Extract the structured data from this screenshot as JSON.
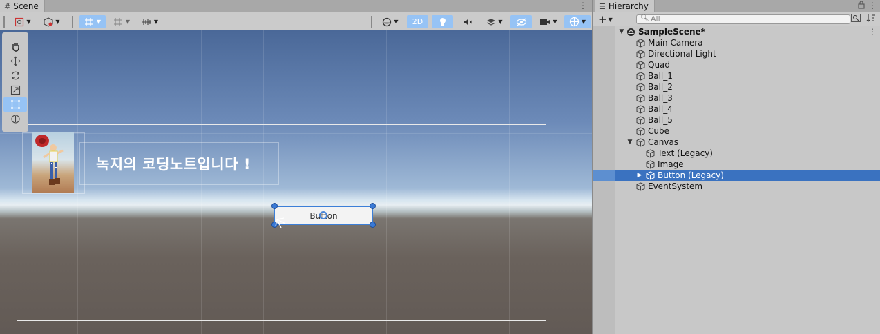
{
  "scene_panel": {
    "tab_icon": "#",
    "tab_label": "Scene",
    "menu_icon": "⋮",
    "toolbar": {
      "mode_2d_label": "2D"
    },
    "viewport": {
      "canvas_text": "녹지의 코딩노트입니다 !",
      "button_label": "Button"
    }
  },
  "hierarchy_panel": {
    "tab_label": "Hierarchy",
    "add_label": "+",
    "search_placeholder": "All",
    "items": [
      {
        "label": "SampleScene*",
        "depth": 0,
        "expanded": true,
        "is_scene": true
      },
      {
        "label": "Main Camera",
        "depth": 1
      },
      {
        "label": "Directional Light",
        "depth": 1
      },
      {
        "label": "Quad",
        "depth": 1
      },
      {
        "label": "Ball_1",
        "depth": 1
      },
      {
        "label": "Ball_2",
        "depth": 1
      },
      {
        "label": "Ball_3",
        "depth": 1
      },
      {
        "label": "Ball_4",
        "depth": 1
      },
      {
        "label": "Ball_5",
        "depth": 1
      },
      {
        "label": "Cube",
        "depth": 1
      },
      {
        "label": "Canvas",
        "depth": 1,
        "expanded": true
      },
      {
        "label": "Text (Legacy)",
        "depth": 2
      },
      {
        "label": "Image",
        "depth": 2
      },
      {
        "label": "Button (Legacy)",
        "depth": 2,
        "collapsed": true,
        "selected": true
      },
      {
        "label": "EventSystem",
        "depth": 1
      }
    ]
  },
  "colors": {
    "selection": "#3a72c0",
    "active_button": "#96c3f5",
    "handle": "#3a7ad6"
  },
  "icons": [
    "grid-icon",
    "lock-icon",
    "hand-icon",
    "move-icon",
    "rotate-icon",
    "scale-icon",
    "rect-icon",
    "transform-icon",
    "cube-icon",
    "unity-scene-icon",
    "search-icon"
  ]
}
